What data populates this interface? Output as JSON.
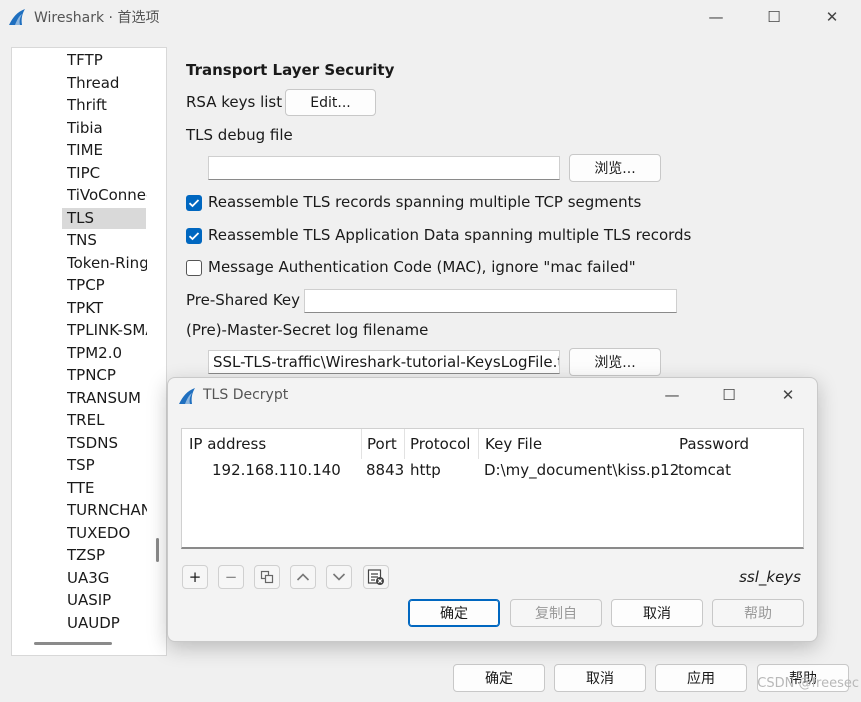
{
  "window": {
    "title": "Wireshark · 首选项",
    "minimize": "—",
    "maximize": "☐",
    "close": "✕"
  },
  "sidebar": {
    "items": [
      "TFTP",
      "Thread",
      "Thrift",
      "Tibia",
      "TIME",
      "TIPC",
      "TiVoConnect",
      "TLS",
      "TNS",
      "Token-Ring",
      "TPCP",
      "TPKT",
      "TPLINK-SMARTHOME",
      "TPM2.0",
      "TPNCP",
      "TRANSUM",
      "TREL",
      "TSDNS",
      "TSP",
      "TTE",
      "TURNCHANNEL",
      "TUXEDO",
      "TZSP",
      "UA3G",
      "UASIP",
      "UAUDP"
    ],
    "selected": "TLS"
  },
  "tls": {
    "section_title": "Transport Layer Security",
    "rsa_label": "RSA keys list",
    "rsa_button": "Edit...",
    "debug_label": "TLS debug file",
    "debug_value": "",
    "browse1": "浏览...",
    "reassemble_records": "Reassemble TLS records spanning multiple TCP segments",
    "reassemble_records_checked": true,
    "reassemble_appdata": "Reassemble TLS Application Data spanning multiple TLS records",
    "reassemble_appdata_checked": true,
    "mac_ignore": "Message Authentication Code (MAC), ignore \"mac failed\"",
    "mac_ignore_checked": false,
    "psk_label": "Pre-Shared Key",
    "psk_value": "",
    "keylog_label": "(Pre)-Master-Secret log filename",
    "keylog_value": "SSL-TLS-traffic\\Wireshark-tutorial-KeysLogFile.txt",
    "browse2": "浏览..."
  },
  "dialog": {
    "title": "TLS Decrypt",
    "columns": [
      "IP address",
      "Port",
      "Protocol",
      "Key File",
      "Password"
    ],
    "rows": [
      {
        "ip": "192.168.110.140",
        "port": "8843",
        "protocol": "http",
        "key_file": "D:\\my_document\\kiss.p12",
        "password": "tomcat"
      }
    ],
    "toolbar": {
      "add": "+",
      "remove": "−",
      "copy": "⧉",
      "up": "∧",
      "down": "∨"
    },
    "uat_name": "ssl_keys",
    "ok": "确定",
    "copy_from": "复制自",
    "cancel": "取消",
    "help": "帮助"
  },
  "footer": {
    "ok": "确定",
    "cancel": "取消",
    "apply": "应用",
    "help": "帮助"
  },
  "watermark": "CSDN @freesec",
  "colors": {
    "accent": "#0067c0",
    "selection": "#d9d9d9"
  }
}
